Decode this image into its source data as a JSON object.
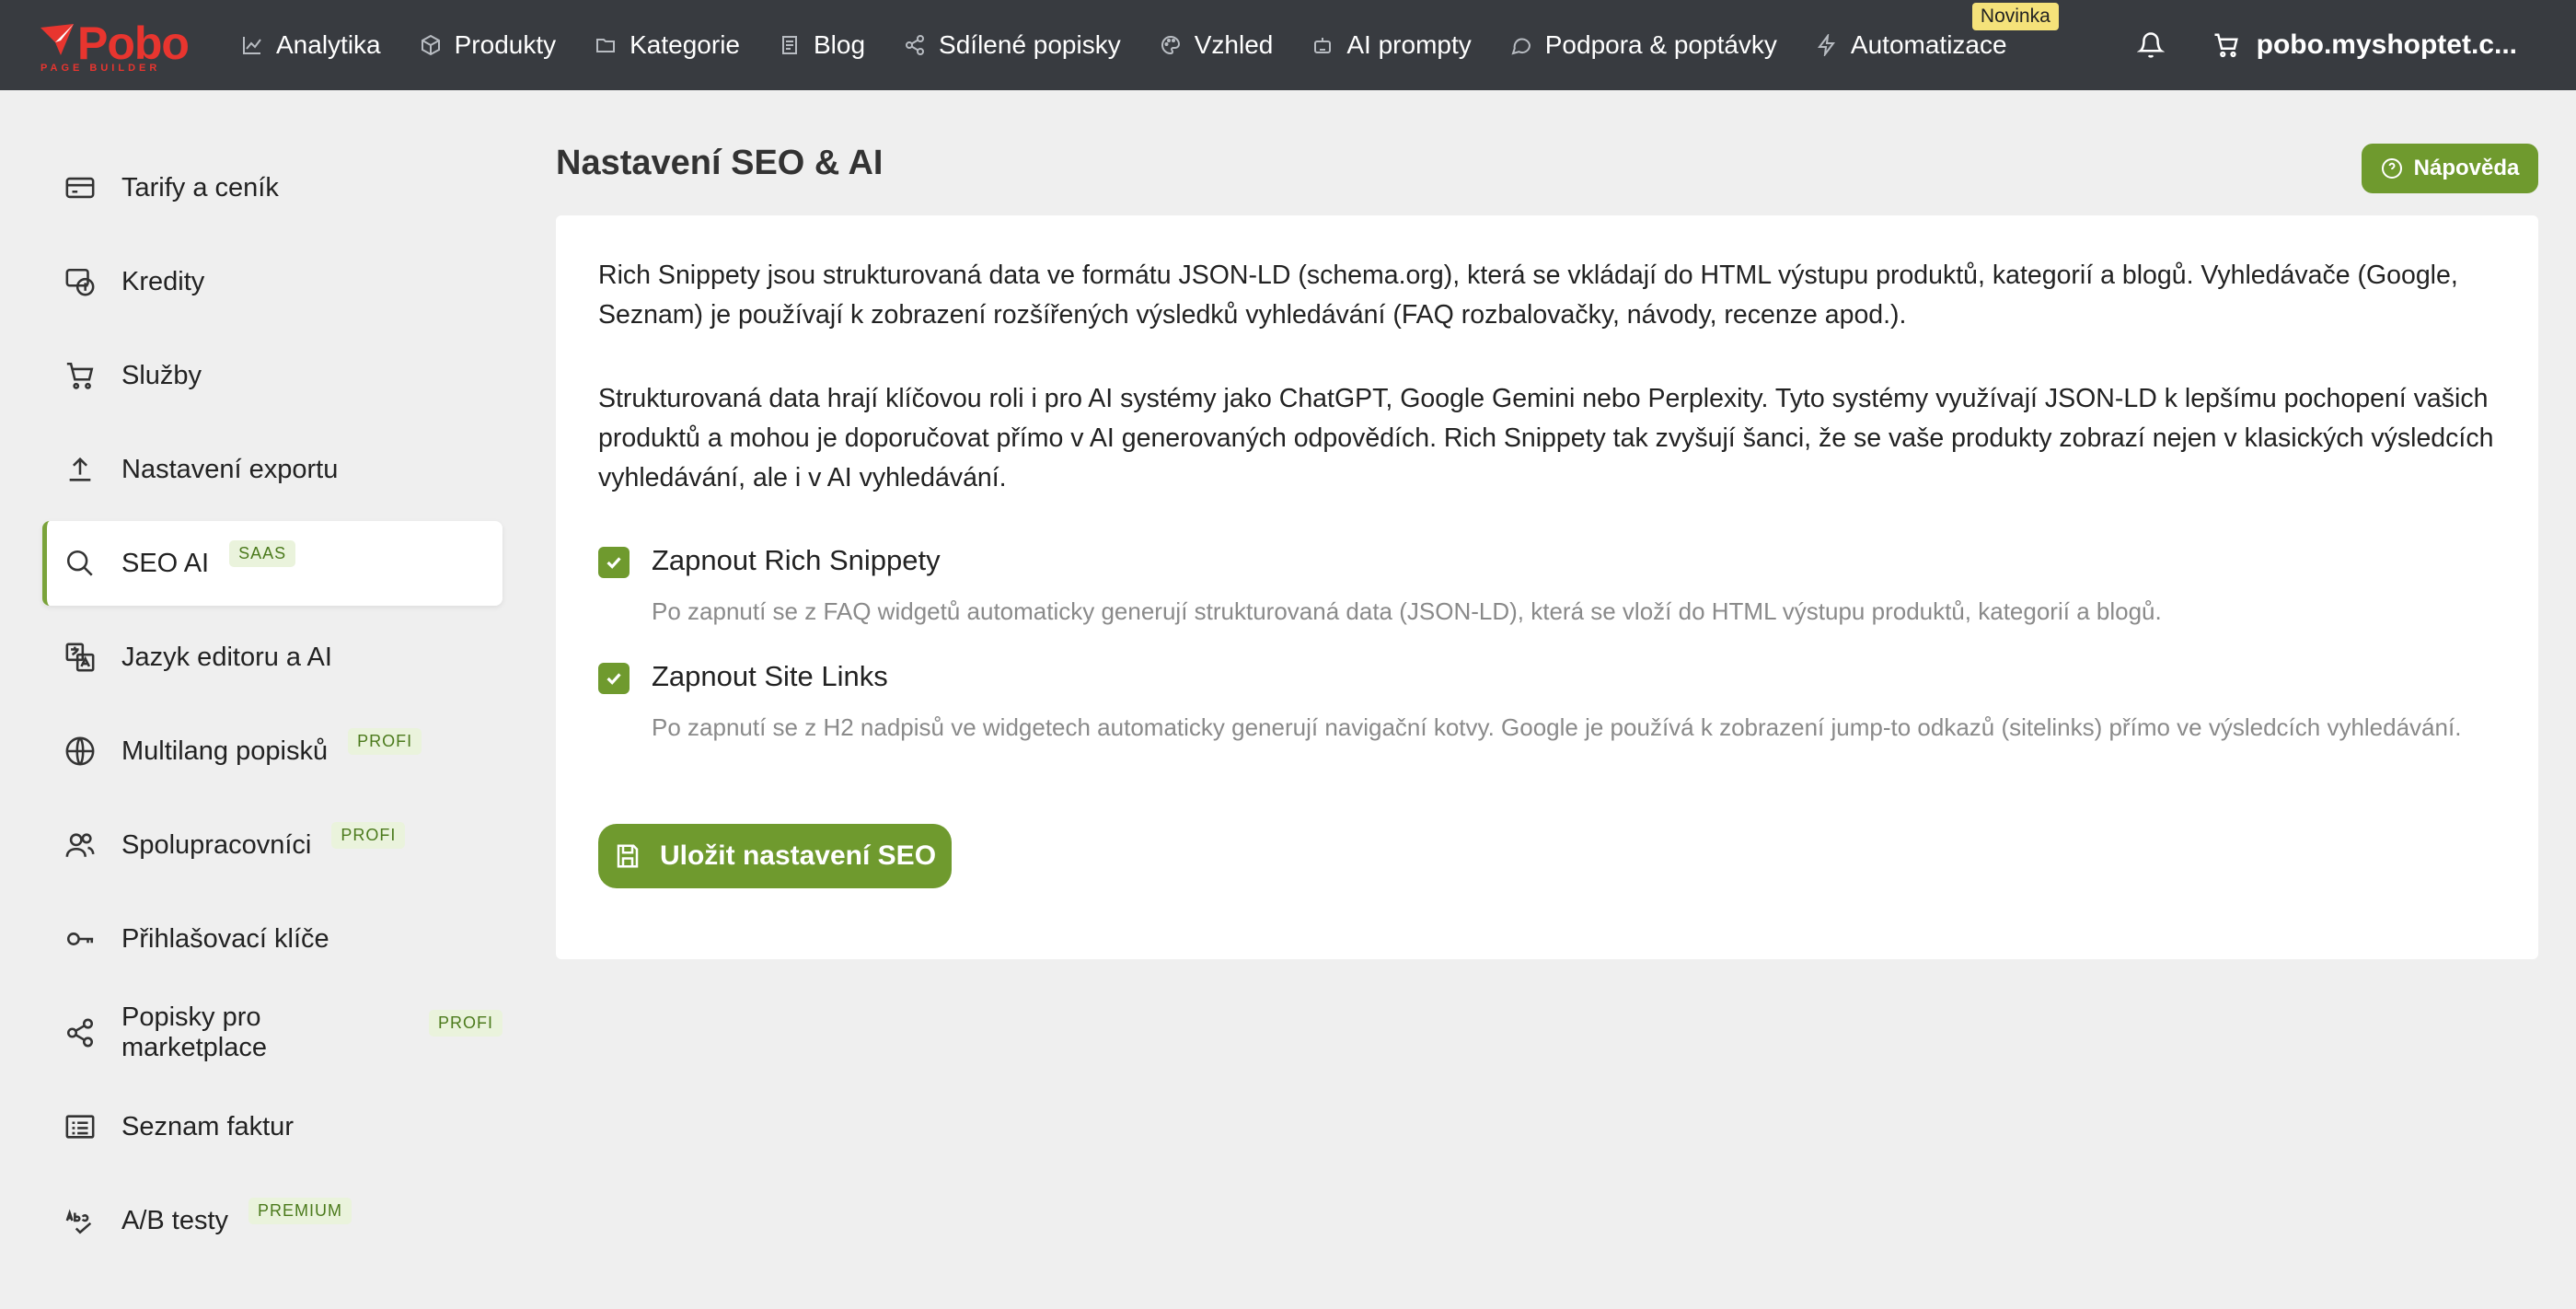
{
  "brand": {
    "name": "Pobo",
    "sub": "PAGE BUILDER",
    "color": "#e8352f"
  },
  "nav": {
    "items": [
      {
        "label": "Analytika",
        "icon": "chart-line-icon"
      },
      {
        "label": "Produkty",
        "icon": "box-icon"
      },
      {
        "label": "Kategorie",
        "icon": "folder-icon"
      },
      {
        "label": "Blog",
        "icon": "document-icon"
      },
      {
        "label": "Sdílené popisky",
        "icon": "share-icon"
      },
      {
        "label": "Vzhled",
        "icon": "palette-icon"
      },
      {
        "label": "AI prompty",
        "icon": "robot-icon"
      },
      {
        "label": "Podpora & poptávky",
        "icon": "chat-icon"
      },
      {
        "label": "Automatizace",
        "icon": "bolt-icon"
      }
    ],
    "new_badge": "Novinka",
    "shop": "pobo.myshoptet.c..."
  },
  "sidebar": {
    "items": [
      {
        "label": "Tarify a ceník",
        "icon": "credit-card-icon"
      },
      {
        "label": "Kredity",
        "icon": "coins-icon"
      },
      {
        "label": "Služby",
        "icon": "cart-icon"
      },
      {
        "label": "Nastavení exportu",
        "icon": "upload-icon"
      },
      {
        "label": "SEO AI",
        "icon": "search-icon",
        "tag": "SAAS",
        "active": true
      },
      {
        "label": "Jazyk editoru a AI",
        "icon": "translate-icon"
      },
      {
        "label": "Multilang popisků",
        "icon": "globe-icon",
        "tag": "PROFI"
      },
      {
        "label": "Spolupracovníci",
        "icon": "users-icon",
        "tag": "PROFI"
      },
      {
        "label": "Přihlašovací klíče",
        "icon": "key-icon"
      },
      {
        "label": "Popisky pro marketplace",
        "icon": "share-icon",
        "tag": "PROFI"
      },
      {
        "label": "Seznam faktur",
        "icon": "list-icon"
      },
      {
        "label": "A/B testy",
        "icon": "spellcheck-icon",
        "tag": "PREMIUM"
      }
    ]
  },
  "main": {
    "title": "Nastavení SEO & AI",
    "help_label": "Nápověda",
    "paragraph1": "Rich Snippety jsou strukturovaná data ve formátu JSON-LD (schema.org), která se vkládají do HTML výstupu produktů, kategorií a blogů. Vyhledávače (Google, Seznam) je používají k zobrazení rozšířených výsledků vyhledávání (FAQ rozbalovačky, návody, recenze apod.).",
    "paragraph2": "Strukturovaná data hrají klíčovou roli i pro AI systémy jako ChatGPT, Google Gemini nebo Perplexity. Tyto systémy využívají JSON-LD k lepšímu pochopení vašich produktů a mohou je doporučovat přímo v AI generovaných odpovědích. Rich Snippety tak zvyšují šanci, že se vaše produkty zobrazí nejen v klasických výsledcích vyhledávání, ale i v AI vyhledávání.",
    "option1": {
      "label": "Zapnout Rich Snippety",
      "checked": true,
      "description": "Po zapnutí se z FAQ widgetů automaticky generují strukturovaná data (JSON-LD), která se vloží do HTML výstupu produktů, kategorií a blogů."
    },
    "option2": {
      "label": "Zapnout Site Links",
      "checked": true,
      "description": "Po zapnutí se z H2 nadpisů ve widgetech automaticky generují navigační kotvy. Google je používá k zobrazení jump-to odkazů (sitelinks) přímo ve výsledcích vyhledávání."
    },
    "save_label": "Uložit nastavení SEO"
  },
  "colors": {
    "accent": "#6f9a2e",
    "topbar": "#383b40",
    "badge": "#f5e27a"
  }
}
